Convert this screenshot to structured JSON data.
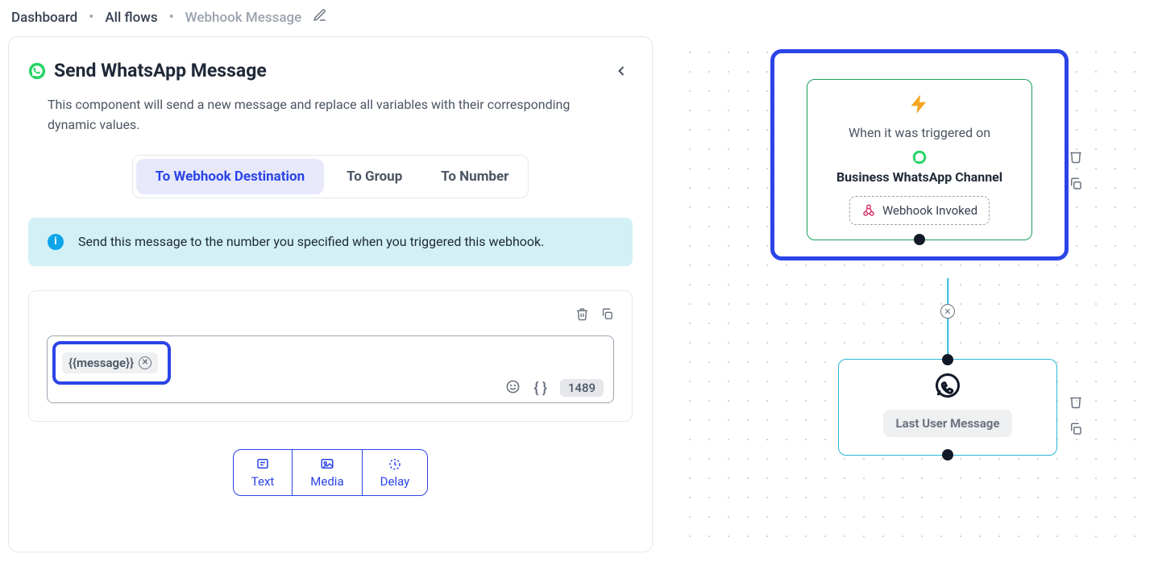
{
  "breadcrumb": {
    "dashboard": "Dashboard",
    "all_flows": "All flows",
    "current": "Webhook Message"
  },
  "panel": {
    "title": "Send WhatsApp Message",
    "description": "This component will send a new message and replace all variables with their corresponding dynamic values.",
    "tabs": {
      "webhook": "To Webhook Destination",
      "group": "To Group",
      "number": "To Number"
    },
    "info_text": "Send this message to the number you specified when you triggered this webhook.",
    "variable_chip": "{{message}}",
    "char_remaining": "1489",
    "actions": {
      "text": "Text",
      "media": "Media",
      "delay": "Delay"
    }
  },
  "canvas": {
    "trigger": {
      "label": "When it was triggered on",
      "channel": "Business WhatsApp Channel",
      "event": "Webhook Invoked"
    },
    "message_node": {
      "pill": "Last User Message"
    }
  },
  "colors": {
    "accent": "#2b44e7",
    "info_bg": "#d2f0f6",
    "green": "#1d9f5a",
    "cyan": "#2bb6d6",
    "amber": "#f5a623"
  }
}
